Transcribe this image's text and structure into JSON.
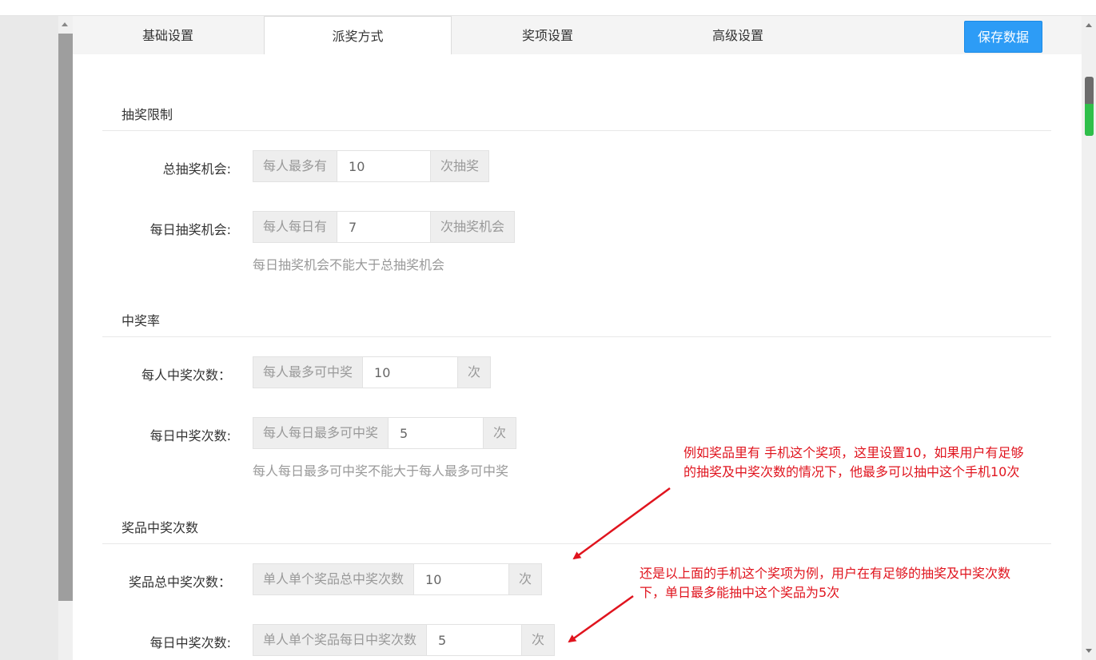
{
  "tabs": [
    "基础设置",
    "派奖方式",
    "奖项设置",
    "高级设置"
  ],
  "active_tab": "派奖方式",
  "save_button": "保存数据",
  "sections": {
    "limit": {
      "title": "抽奖限制",
      "total": {
        "label": "总抽奖机会:",
        "prefix": "每人最多有",
        "value": "10",
        "suffix": "次抽奖"
      },
      "daily": {
        "label": "每日抽奖机会:",
        "prefix": "每人每日有",
        "value": "7",
        "suffix": "次抽奖机会"
      },
      "help": "每日抽奖机会不能大于总抽奖机会"
    },
    "rate": {
      "title": "中奖率",
      "per_person": {
        "label": "每人中奖次数：",
        "prefix": "每人最多可中奖",
        "value": "10",
        "suffix": "次"
      },
      "daily": {
        "label": "每日中奖次数:",
        "prefix": "每人每日最多可中奖",
        "value": "5",
        "suffix": "次"
      },
      "help": "每人每日最多可中奖不能大于每人最多可中奖"
    },
    "prize": {
      "title": "奖品中奖次数",
      "total": {
        "label": "奖品总中奖次数：",
        "prefix": "单人单个奖品总中奖次数",
        "value": "10",
        "suffix": "次"
      },
      "daily": {
        "label": "每日中奖次数:",
        "prefix": "单人单个奖品每日中奖次数",
        "value": "5",
        "suffix": "次"
      }
    }
  },
  "annotations": {
    "note1": [
      "例如奖品里有 手机这个奖项，这里设置10，如果用户有足够",
      "的抽奖及中奖次数的情况下，他最多可以抽中这个手机10次"
    ],
    "note2": [
      "还是以上面的手机这个奖项为例，用户在有足够的抽奖及中奖次数",
      "下，单日最多能抽中这个奖品为5次"
    ]
  },
  "colors": {
    "accent": "#2d9cf6",
    "annotation": "#e0141e",
    "scroll_indicator": "#2fbf4a"
  }
}
